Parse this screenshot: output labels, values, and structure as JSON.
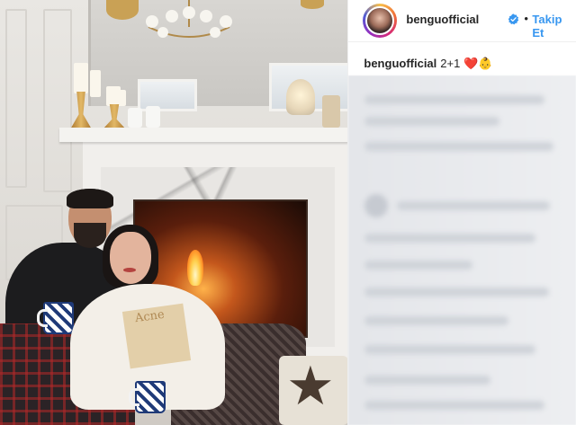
{
  "post": {
    "username": "benguofficial",
    "verified_icon": "verified-badge-icon",
    "separator": "•",
    "follow_label": "Takip Et",
    "caption": {
      "username": "benguofficial",
      "text": "2+1 ❤️👶"
    },
    "photo": {
      "subject": "couple-by-fireplace-photo",
      "print_text": "Acne"
    },
    "comments_state": "blurred"
  },
  "colors": {
    "link_blue": "#3897f0",
    "text_dark": "#262626",
    "verified_blue": "#3897f0",
    "divider": "#efefef"
  }
}
